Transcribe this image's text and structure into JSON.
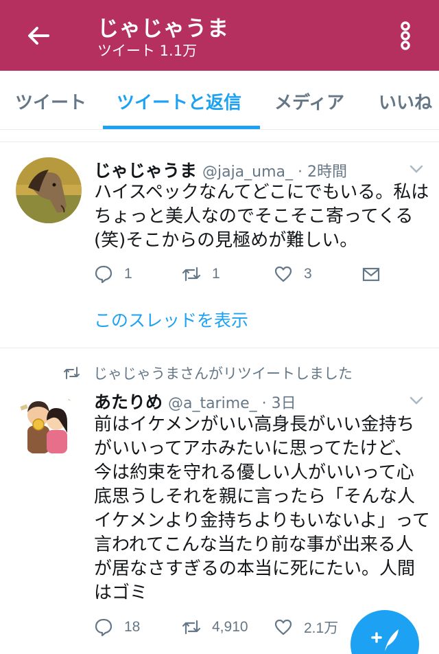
{
  "app_bar": {
    "title": "じゃじゃうま",
    "subtitle": "ツイート 1.1万",
    "accent": "#b5305f"
  },
  "tabs": [
    {
      "label": "ツイート",
      "active": false
    },
    {
      "label": "ツイートと返信",
      "active": true
    },
    {
      "label": "メディア",
      "active": false
    },
    {
      "label": "いいね",
      "active": false
    }
  ],
  "tweets": [
    {
      "display_name": "じゃじゃうま",
      "handle_time": "@jaja_uma_ · 2時間",
      "text": "ハイスペックなんてどこにでもいる。私はちょっと美人なのでそこそこ寄ってくる(笑)そこからの見極めが難しい。",
      "replies": "1",
      "retweets": "1",
      "likes": "3",
      "thread_link": "このスレッドを表示",
      "avatar_icon": "horse-avatar"
    },
    {
      "retweet_notice": "じゃじゃうまさんがリツイートしました",
      "display_name": "あたりめ",
      "handle_time": "@a_tarime_ · 3日",
      "text": "前はイケメンがいい高身長がいい金持ちがいいってアホみたいに思ってたけど、今は約束を守れる優しい人がいいって心底思うしそれを親に言ったら「そんな人イケメンより金持ちよりもいないよ」って言われてこんな当たり前な事が出来る人が居なさすぎるの本当に死にたい。人間はゴミ",
      "replies": "18",
      "retweets": "4,910",
      "likes": "2.1万",
      "avatar_icon": "couple-illustration-avatar"
    }
  ],
  "colors": {
    "link": "#1da1f2",
    "muted": "#657786"
  }
}
